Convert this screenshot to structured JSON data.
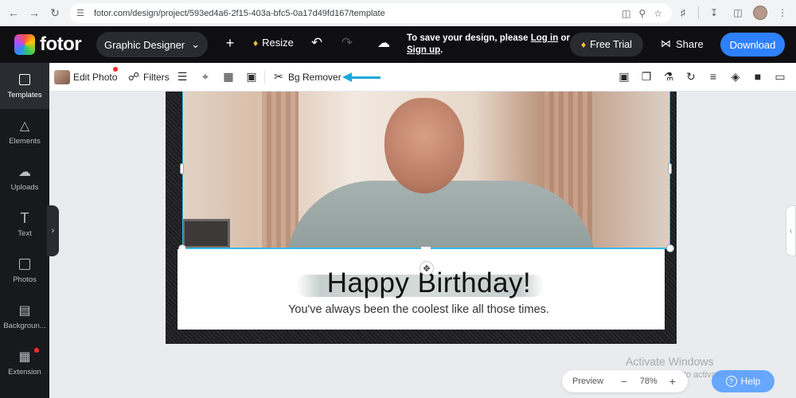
{
  "browser": {
    "url": "fotor.com/design/project/593ed4a6-2f15-403a-bfc5-0a17d49fd167/template"
  },
  "topbar": {
    "logo": "fotor",
    "designer_label": "Graphic Designer",
    "resize_label": "Resize",
    "save_prefix": "To save your design, please",
    "login_label": "Log in",
    "or_label": "or",
    "signup_label": "Sign up",
    "signup_suffix": ".",
    "free_trial_label": "Free Trial",
    "share_label": "Share",
    "download_label": "Download"
  },
  "sidebar": {
    "items": [
      {
        "label": "Templates"
      },
      {
        "label": "Elements"
      },
      {
        "label": "Uploads"
      },
      {
        "label": "Text"
      },
      {
        "label": "Photos"
      },
      {
        "label": "Backgroun..."
      },
      {
        "label": "Extension"
      }
    ]
  },
  "toolbar": {
    "edit_photo": "Edit Photo",
    "filters": "Filters",
    "bg_remover": "Bg Remover"
  },
  "canvas": {
    "title": "Happy Birthday!",
    "subtitle": "You've always been the coolest like all those times."
  },
  "watermark": {
    "line1": "Activate Windows",
    "line2": "Go to Settings to activate Windows."
  },
  "zoom": {
    "preview_label": "Preview",
    "minus": "−",
    "value": "78%",
    "plus": "+"
  },
  "help_label": "Help",
  "colors": {
    "accent": "#2f80ff",
    "arrow": "#18a9d8",
    "selection": "#3fb7e8",
    "topbar_bg": "#0f0f12",
    "sidebar_bg": "#18191c"
  }
}
